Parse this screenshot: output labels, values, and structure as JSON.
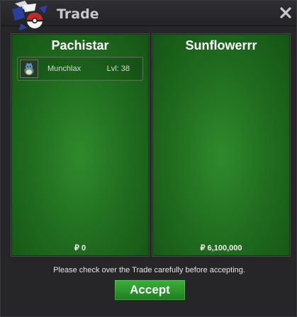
{
  "window": {
    "title": "Trade"
  },
  "panels": [
    {
      "name": "Pachistar",
      "items": [
        {
          "name": "Munchlax",
          "level": "Lvl: 38",
          "icon": "munchlax-sprite-icon"
        }
      ],
      "money": "₽ 0"
    },
    {
      "name": "Sunflowerrr",
      "items": [],
      "money": "₽ 6,100,000"
    }
  ],
  "notice": "Please check over the Trade carefully before accepting.",
  "accept_label": "Accept",
  "colors": {
    "panel_green": "#1f6a1e",
    "accept_green": "#2e9a2d",
    "background": "#262629"
  }
}
